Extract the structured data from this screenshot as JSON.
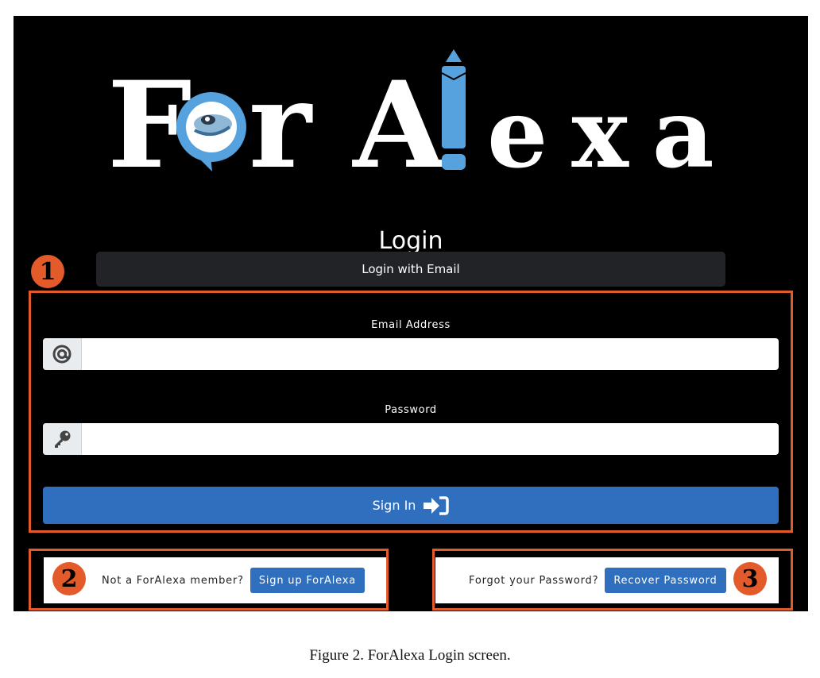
{
  "logo": {
    "part1": "F",
    "part2": "r A",
    "part3": "exa",
    "accent_color": "#55a2de"
  },
  "login": {
    "title": "Login",
    "email_tab_label": "Login with Email",
    "email_label": "Email Address",
    "email_value": "",
    "email_addon_icon": "at-icon",
    "password_label": "Password",
    "password_value": "",
    "password_addon_icon": "key-icon",
    "signin_label": "Sign In",
    "signin_icon": "sign-in-icon",
    "button_color": "#2f6fbd"
  },
  "signup": {
    "prompt": "Not a ForAlexa member?",
    "button_label": "Sign up ForAlexa"
  },
  "recover": {
    "prompt": "Forgot your Password?",
    "button_label": "Recover Password"
  },
  "annotations": {
    "marker_1": "1",
    "marker_2": "2",
    "marker_3": "3",
    "color": "#e35a2b"
  },
  "caption": "Figure 2. ForAlexa Login screen."
}
